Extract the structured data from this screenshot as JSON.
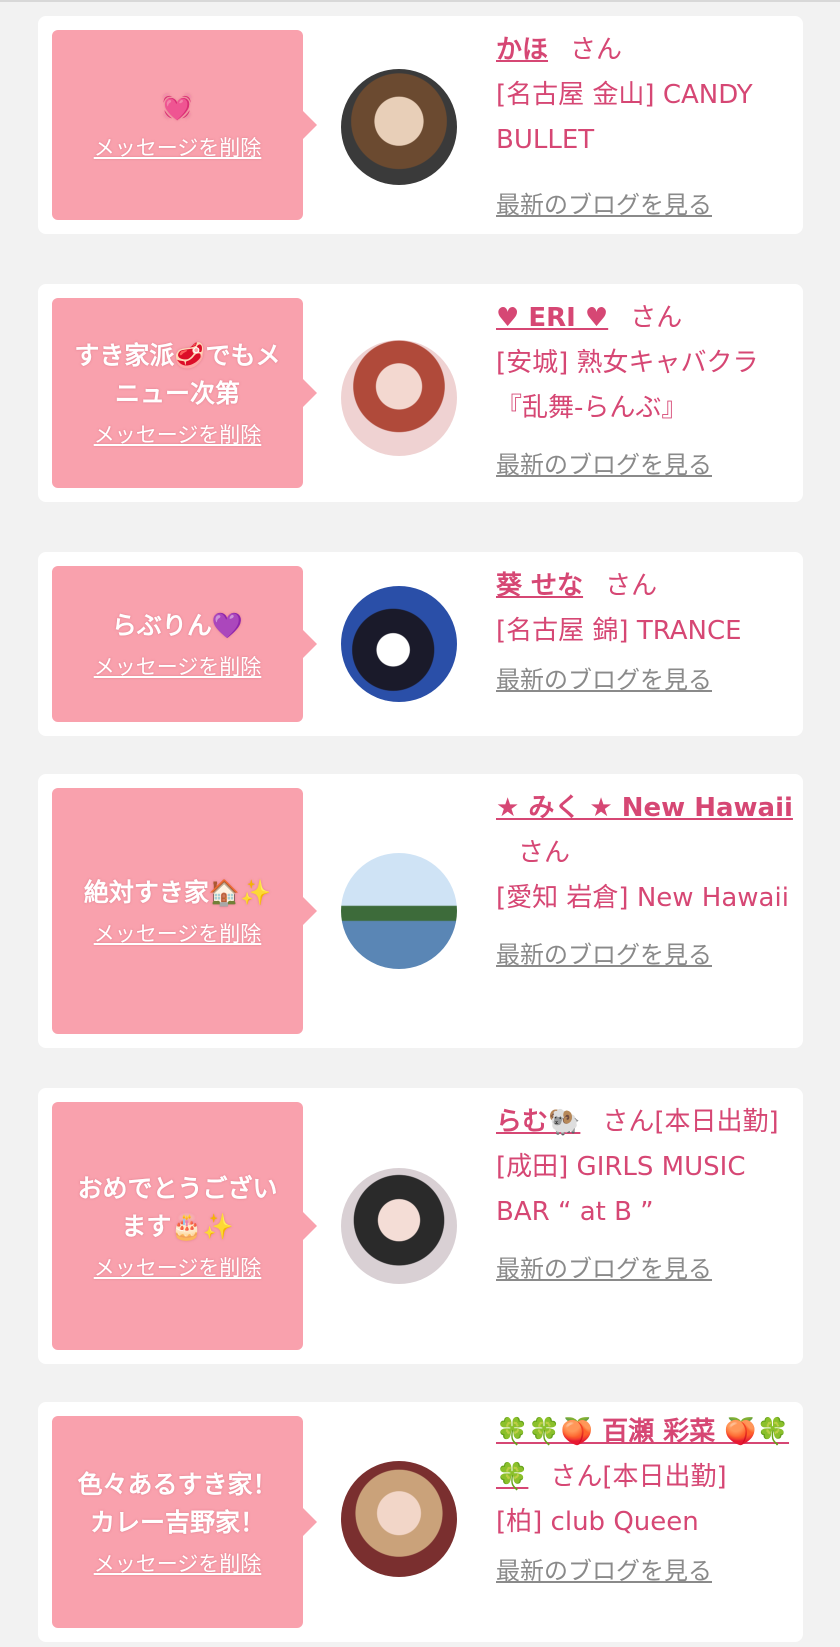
{
  "delete_label": "メッセージを削除",
  "blog_label": "最新のブログを見る",
  "san_suffix": "さん",
  "cards": [
    {
      "message": "💓",
      "name": "かほ",
      "suffix": "さん",
      "shop": "[名古屋 金山] CANDY BULLET"
    },
    {
      "message": "すき家派🥩でもメニュー次第",
      "name": "♥ ERI ♥",
      "suffix": "さん",
      "shop": "[安城] 熟女キャバクラ『乱舞-らんぶ』"
    },
    {
      "message": "らぶりん💜",
      "name": "葵 せな",
      "suffix": "さん",
      "shop": "[名古屋 錦] TRANCE"
    },
    {
      "message": "絶対すき家🏠✨",
      "name": "★ みく ★ New Hawaii",
      "suffix": "さん",
      "shop": "[愛知 岩倉] New Hawaii"
    },
    {
      "message": "おめでとうございます🎂✨",
      "name": "らむ🐏",
      "suffix": "さん[本日出勤]",
      "shop": "[成田] GIRLS MUSIC BAR “ at B ”"
    },
    {
      "message": "色々あるすき家！カレー吉野家！",
      "name": "🍀🍀🍑 百瀬 彩菜 🍑🍀🍀",
      "suffix": "さん[本日出勤]",
      "shop": "[柏] club Queen"
    }
  ],
  "colors": {
    "bubble": "#f9a1ad",
    "accent": "#d64774",
    "link_gray": "#8a8a8a",
    "background": "#f2f2f2"
  }
}
